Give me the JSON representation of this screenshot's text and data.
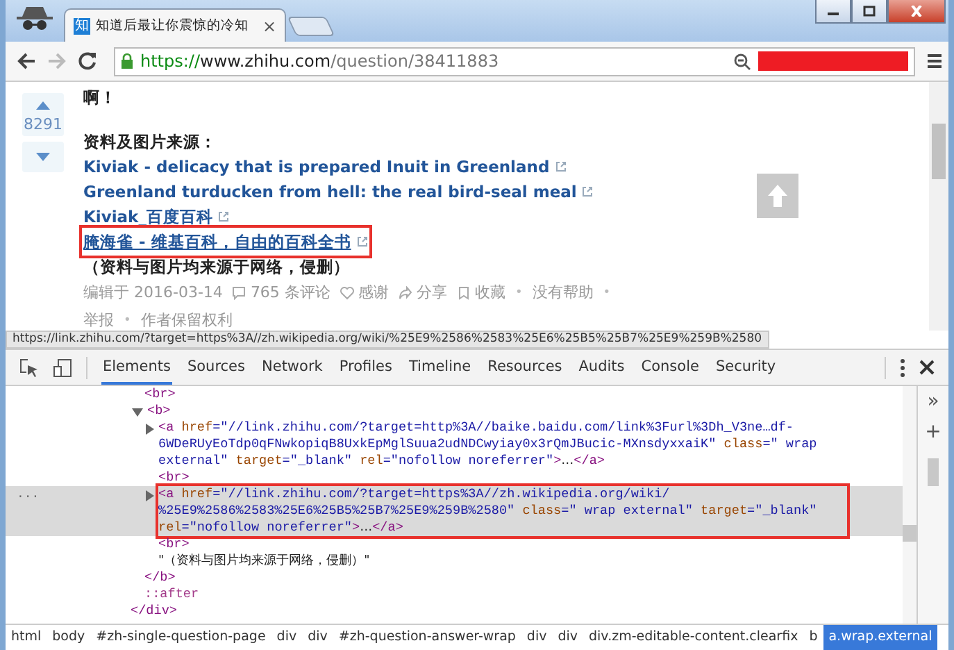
{
  "window": {
    "tab": {
      "favicon": "知",
      "title": "知道后最让你震惊的冷知",
      "close": "×"
    }
  },
  "address_bar": {
    "scheme": "https://",
    "host": "www.zhihu.com",
    "path": "/question/38411883",
    "forward_disabled": true
  },
  "page": {
    "vote_count": "8291",
    "lines": [
      {
        "kind": "text",
        "text": "啊！"
      },
      {
        "kind": "heading",
        "text": "资料及图片来源："
      },
      {
        "kind": "link",
        "text": "Kiviak - delicacy that is prepared Inuit in Greenland",
        "hovered": false,
        "boxed": false
      },
      {
        "kind": "link",
        "text": "Greenland turducken from hell: the real bird-seal meal",
        "hovered": false,
        "boxed": false
      },
      {
        "kind": "link",
        "text": "Kiviak_百度百科",
        "hovered": false,
        "boxed": false
      },
      {
        "kind": "link",
        "text": "腌海雀 - 维基百科，自由的百科全书",
        "hovered": true,
        "boxed": true
      },
      {
        "kind": "text",
        "text": "（资料与图片均来源于网络，侵删）"
      }
    ],
    "meta": [
      {
        "kind": "plain",
        "text": "编辑于 2016-03-14"
      },
      {
        "kind": "comment",
        "text": "765 条评论"
      },
      {
        "kind": "heart",
        "text": "感谢"
      },
      {
        "kind": "share",
        "text": "分享"
      },
      {
        "kind": "bookmark",
        "text": "收藏"
      },
      {
        "kind": "sep",
        "text": "•"
      },
      {
        "kind": "plain",
        "text": "没有帮助"
      },
      {
        "kind": "sep",
        "text": "•"
      }
    ],
    "meta2": [
      {
        "kind": "plain",
        "text": "举报"
      },
      {
        "kind": "sep",
        "text": "•"
      },
      {
        "kind": "plain",
        "text": "作者保留权利"
      }
    ],
    "status_url": "https://link.zhihu.com/?target=https%3A//zh.wikipedia.org/wiki/%25E9%2586%2583%25E6%25B5%25B7%25E9%259B%2580"
  },
  "devtools": {
    "tabs": [
      {
        "label": "Elements",
        "selected": true
      },
      {
        "label": "Sources",
        "selected": false
      },
      {
        "label": "Network",
        "selected": false
      },
      {
        "label": "Profiles",
        "selected": false
      },
      {
        "label": "Timeline",
        "selected": false
      },
      {
        "label": "Resources",
        "selected": false
      },
      {
        "label": "Audits",
        "selected": false
      },
      {
        "label": "Console",
        "selected": false
      },
      {
        "label": "Security",
        "selected": false
      }
    ],
    "side_buttons": [
      "»",
      "+"
    ],
    "dom": {
      "close": "</div>",
      "children": [
        {
          "tokens": [
            {
              "kind": "tag",
              "text": "<br>"
            }
          ]
        },
        {
          "tokens": [
            {
              "kind": "tag",
              "text": "<b>"
            }
          ],
          "expanded": true,
          "close": "</b>",
          "children": [
            {
              "tokens": [
                {
                  "kind": "tag",
                  "text": "<a"
                },
                {
                  "kind": "attr",
                  "text": " href"
                },
                {
                  "kind": "value",
                  "text": "=\"//link.zhihu.com/?target=http%3A//baike.baidu.com/link%3Furl%3Dh_V3ne…df-6WDeRUyEoTdp0qFNwkopiqB8UxkEpMglSuua2udNDCwyiay0x3rQmJBucic-MXnsdyxxaiK\""
                },
                {
                  "kind": "attr",
                  "text": " class"
                },
                {
                  "kind": "value",
                  "text": "=\" wrap external\""
                },
                {
                  "kind": "attr",
                  "text": " target"
                },
                {
                  "kind": "value",
                  "text": "=\"_blank\""
                },
                {
                  "kind": "attr",
                  "text": " rel"
                },
                {
                  "kind": "value",
                  "text": "=\"nofollow noreferrer\""
                },
                {
                  "kind": "tag",
                  "text": ">"
                },
                {
                  "kind": "text",
                  "text": "…"
                },
                {
                  "kind": "tag",
                  "text": "</a>"
                }
              ],
              "expanded": false,
              "selected": false,
              "boxed": false
            },
            {
              "tokens": [
                {
                  "kind": "tag",
                  "text": "<br>"
                }
              ]
            },
            {
              "tokens": [
                {
                  "kind": "tag",
                  "text": "<a"
                },
                {
                  "kind": "attr",
                  "text": " href"
                },
                {
                  "kind": "value",
                  "text": "=\"//link.zhihu.com/?target=https%3A//zh.wikipedia.org/wiki/ %25E9%2586%2583%25E6%25B5%25B7%25E9%259B%2580\""
                },
                {
                  "kind": "attr",
                  "text": " class"
                },
                {
                  "kind": "value",
                  "text": "=\" wrap external\""
                },
                {
                  "kind": "attr",
                  "text": " target"
                },
                {
                  "kind": "value",
                  "text": "=\"_blank\""
                },
                {
                  "kind": "attr",
                  "text": " rel"
                },
                {
                  "kind": "value",
                  "text": "=\"nofollow noreferrer\""
                },
                {
                  "kind": "tag",
                  "text": ">"
                },
                {
                  "kind": "text",
                  "text": "…"
                },
                {
                  "kind": "tag",
                  "text": "</a>"
                }
              ],
              "expanded": false,
              "selected": true,
              "boxed": true,
              "gutter": "..."
            },
            {
              "tokens": [
                {
                  "kind": "tag",
                  "text": "<br>"
                }
              ]
            },
            {
              "tokens": [
                {
                  "kind": "text",
                  "text": "\"（资料与图片均来源于网络，侵删）\""
                }
              ]
            }
          ]
        },
        {
          "tokens": [
            {
              "kind": "pseudo",
              "text": "::after"
            }
          ]
        }
      ]
    },
    "breadcrumbs": [
      {
        "label": "html",
        "selected": false
      },
      {
        "label": "body",
        "selected": false
      },
      {
        "label": "#zh-single-question-page",
        "selected": false
      },
      {
        "label": "div",
        "selected": false
      },
      {
        "label": "div",
        "selected": false
      },
      {
        "label": "#zh-question-answer-wrap",
        "selected": false
      },
      {
        "label": "div",
        "selected": false
      },
      {
        "label": "div",
        "selected": false
      },
      {
        "label": "div.zm-editable-content.clearfix",
        "selected": false
      },
      {
        "label": "b",
        "selected": false
      },
      {
        "label": "a.wrap.external",
        "selected": true
      }
    ]
  }
}
